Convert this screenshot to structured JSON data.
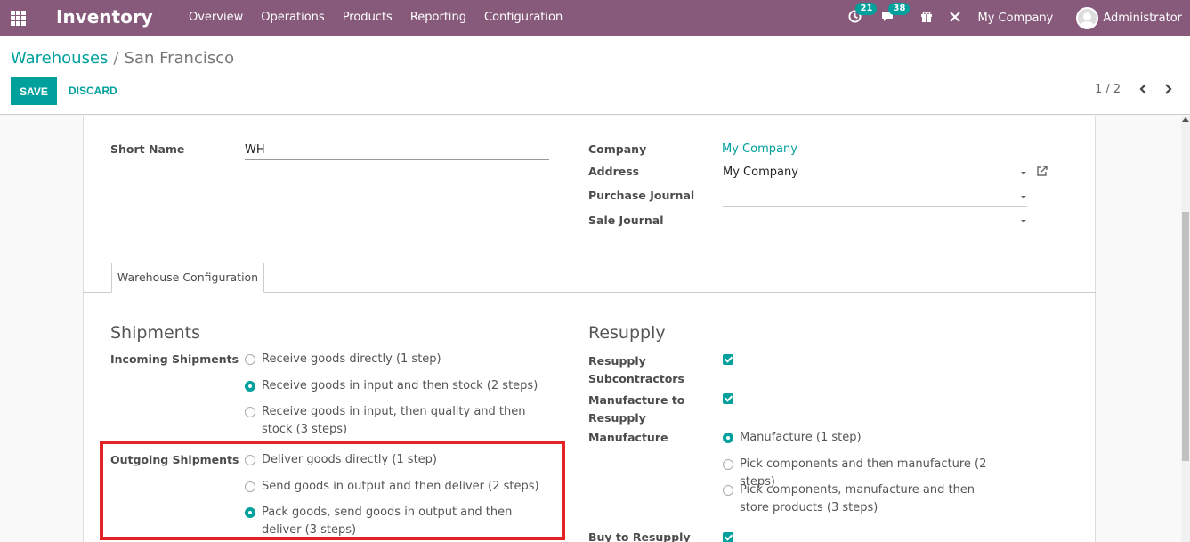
{
  "navbar": {
    "brand": "Inventory",
    "menu": [
      "Overview",
      "Operations",
      "Products",
      "Reporting",
      "Configuration"
    ],
    "activities_count": "21",
    "messages_count": "38",
    "company": "My Company",
    "user": "Administrator"
  },
  "breadcrumb": {
    "parent": "Warehouses",
    "separator": "/",
    "current": "San Francisco"
  },
  "buttons": {
    "save": "SAVE",
    "discard": "DISCARD"
  },
  "pager": {
    "value": "1 / 2"
  },
  "form": {
    "short_name_label": "Short Name",
    "short_name_value": "WH",
    "company_label": "Company",
    "company_value": "My Company",
    "address_label": "Address",
    "address_value": "My Company",
    "purchase_journal_label": "Purchase Journal",
    "purchase_journal_value": "",
    "sale_journal_label": "Sale Journal",
    "sale_journal_value": ""
  },
  "tabs": [
    "Warehouse Configuration"
  ],
  "shipments": {
    "title": "Shipments",
    "incoming_label": "Incoming Shipments",
    "incoming_options": [
      {
        "label": "Receive goods directly (1 step)",
        "checked": false
      },
      {
        "label": "Receive goods in input and then stock (2 steps)",
        "checked": true
      },
      {
        "label": "Receive goods in input, then quality and then stock (3 steps)",
        "checked": false
      }
    ],
    "outgoing_label": "Outgoing Shipments",
    "outgoing_options": [
      {
        "label": "Deliver goods directly (1 step)",
        "checked": false
      },
      {
        "label": "Send goods in output and then deliver (2 steps)",
        "checked": false
      },
      {
        "label": "Pack goods, send goods in output and then deliver (3 steps)",
        "checked": true
      }
    ]
  },
  "resupply": {
    "title": "Resupply",
    "resupply_subcontractors_label": "Resupply Subcontractors",
    "resupply_subcontractors_checked": true,
    "manufacture_to_resupply_label": "Manufacture to Resupply",
    "manufacture_to_resupply_checked": true,
    "manufacture_label": "Manufacture",
    "manufacture_options": [
      {
        "label": "Manufacture (1 step)",
        "checked": true
      },
      {
        "label": "Pick components and then manufacture (2 steps)",
        "checked": false
      },
      {
        "label": "Pick components, manufacture and then store products (3 steps)",
        "checked": false
      }
    ],
    "buy_to_resupply_label": "Buy to Resupply",
    "buy_to_resupply_checked": true
  },
  "colors": {
    "navbar": "#875a7b",
    "accent": "#00a09d",
    "highlight": "#e52326"
  }
}
